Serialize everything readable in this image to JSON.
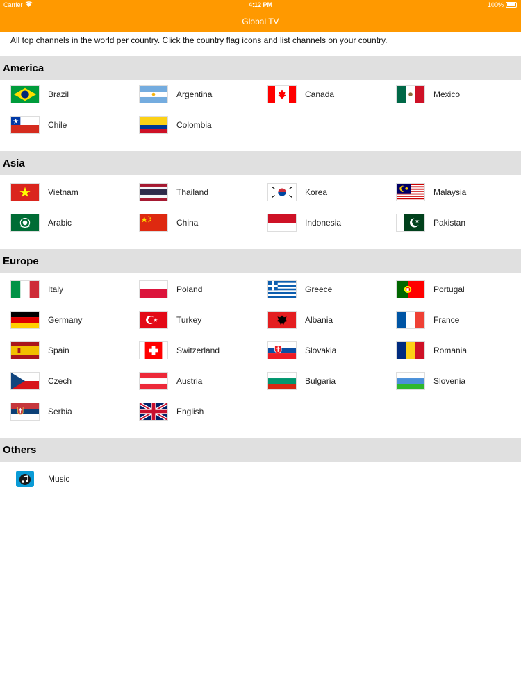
{
  "status_bar": {
    "carrier": "Carrier",
    "time": "4:12 PM",
    "battery": "100%"
  },
  "app": {
    "title": "Global TV"
  },
  "intro": "All top channels in the world per country. Click the country flag icons and list channels on your country.",
  "sections": [
    {
      "title": "America",
      "items": [
        {
          "label": "Brazil",
          "icon": "brazil-flag"
        },
        {
          "label": "Argentina",
          "icon": "argentina-flag"
        },
        {
          "label": "Canada",
          "icon": "canada-flag"
        },
        {
          "label": "Mexico",
          "icon": "mexico-flag"
        },
        {
          "label": "Chile",
          "icon": "chile-flag"
        },
        {
          "label": "Colombia",
          "icon": "colombia-flag"
        }
      ]
    },
    {
      "title": "Asia",
      "items": [
        {
          "label": "Vietnam",
          "icon": "vietnam-flag"
        },
        {
          "label": "Thailand",
          "icon": "thailand-flag"
        },
        {
          "label": "Korea",
          "icon": "korea-flag"
        },
        {
          "label": "Malaysia",
          "icon": "malaysia-flag"
        },
        {
          "label": "Arabic",
          "icon": "arabic-flag"
        },
        {
          "label": "China",
          "icon": "china-flag"
        },
        {
          "label": "Indonesia",
          "icon": "indonesia-flag"
        },
        {
          "label": "Pakistan",
          "icon": "pakistan-flag"
        }
      ]
    },
    {
      "title": "Europe",
      "items": [
        {
          "label": "Italy",
          "icon": "italy-flag"
        },
        {
          "label": "Poland",
          "icon": "poland-flag"
        },
        {
          "label": "Greece",
          "icon": "greece-flag"
        },
        {
          "label": "Portugal",
          "icon": "portugal-flag"
        },
        {
          "label": "Germany",
          "icon": "germany-flag"
        },
        {
          "label": "Turkey",
          "icon": "turkey-flag"
        },
        {
          "label": "Albania",
          "icon": "albania-flag"
        },
        {
          "label": "France",
          "icon": "france-flag"
        },
        {
          "label": "Spain",
          "icon": "spain-flag"
        },
        {
          "label": "Switzerland",
          "icon": "switzerland-flag"
        },
        {
          "label": "Slovakia",
          "icon": "slovakia-flag"
        },
        {
          "label": "Romania",
          "icon": "romania-flag"
        },
        {
          "label": "Czech",
          "icon": "czech-flag"
        },
        {
          "label": "Austria",
          "icon": "austria-flag"
        },
        {
          "label": "Bulgaria",
          "icon": "bulgaria-flag"
        },
        {
          "label": "Slovenia",
          "icon": "slovenia-flag"
        },
        {
          "label": "Serbia",
          "icon": "serbia-flag"
        },
        {
          "label": "English",
          "icon": "uk-flag"
        }
      ]
    },
    {
      "title": "Others",
      "items": [
        {
          "label": "Music",
          "icon": "music-icon"
        }
      ]
    }
  ],
  "colors": {
    "header": "#FF9900",
    "section_bg": "#e0e0e0"
  }
}
